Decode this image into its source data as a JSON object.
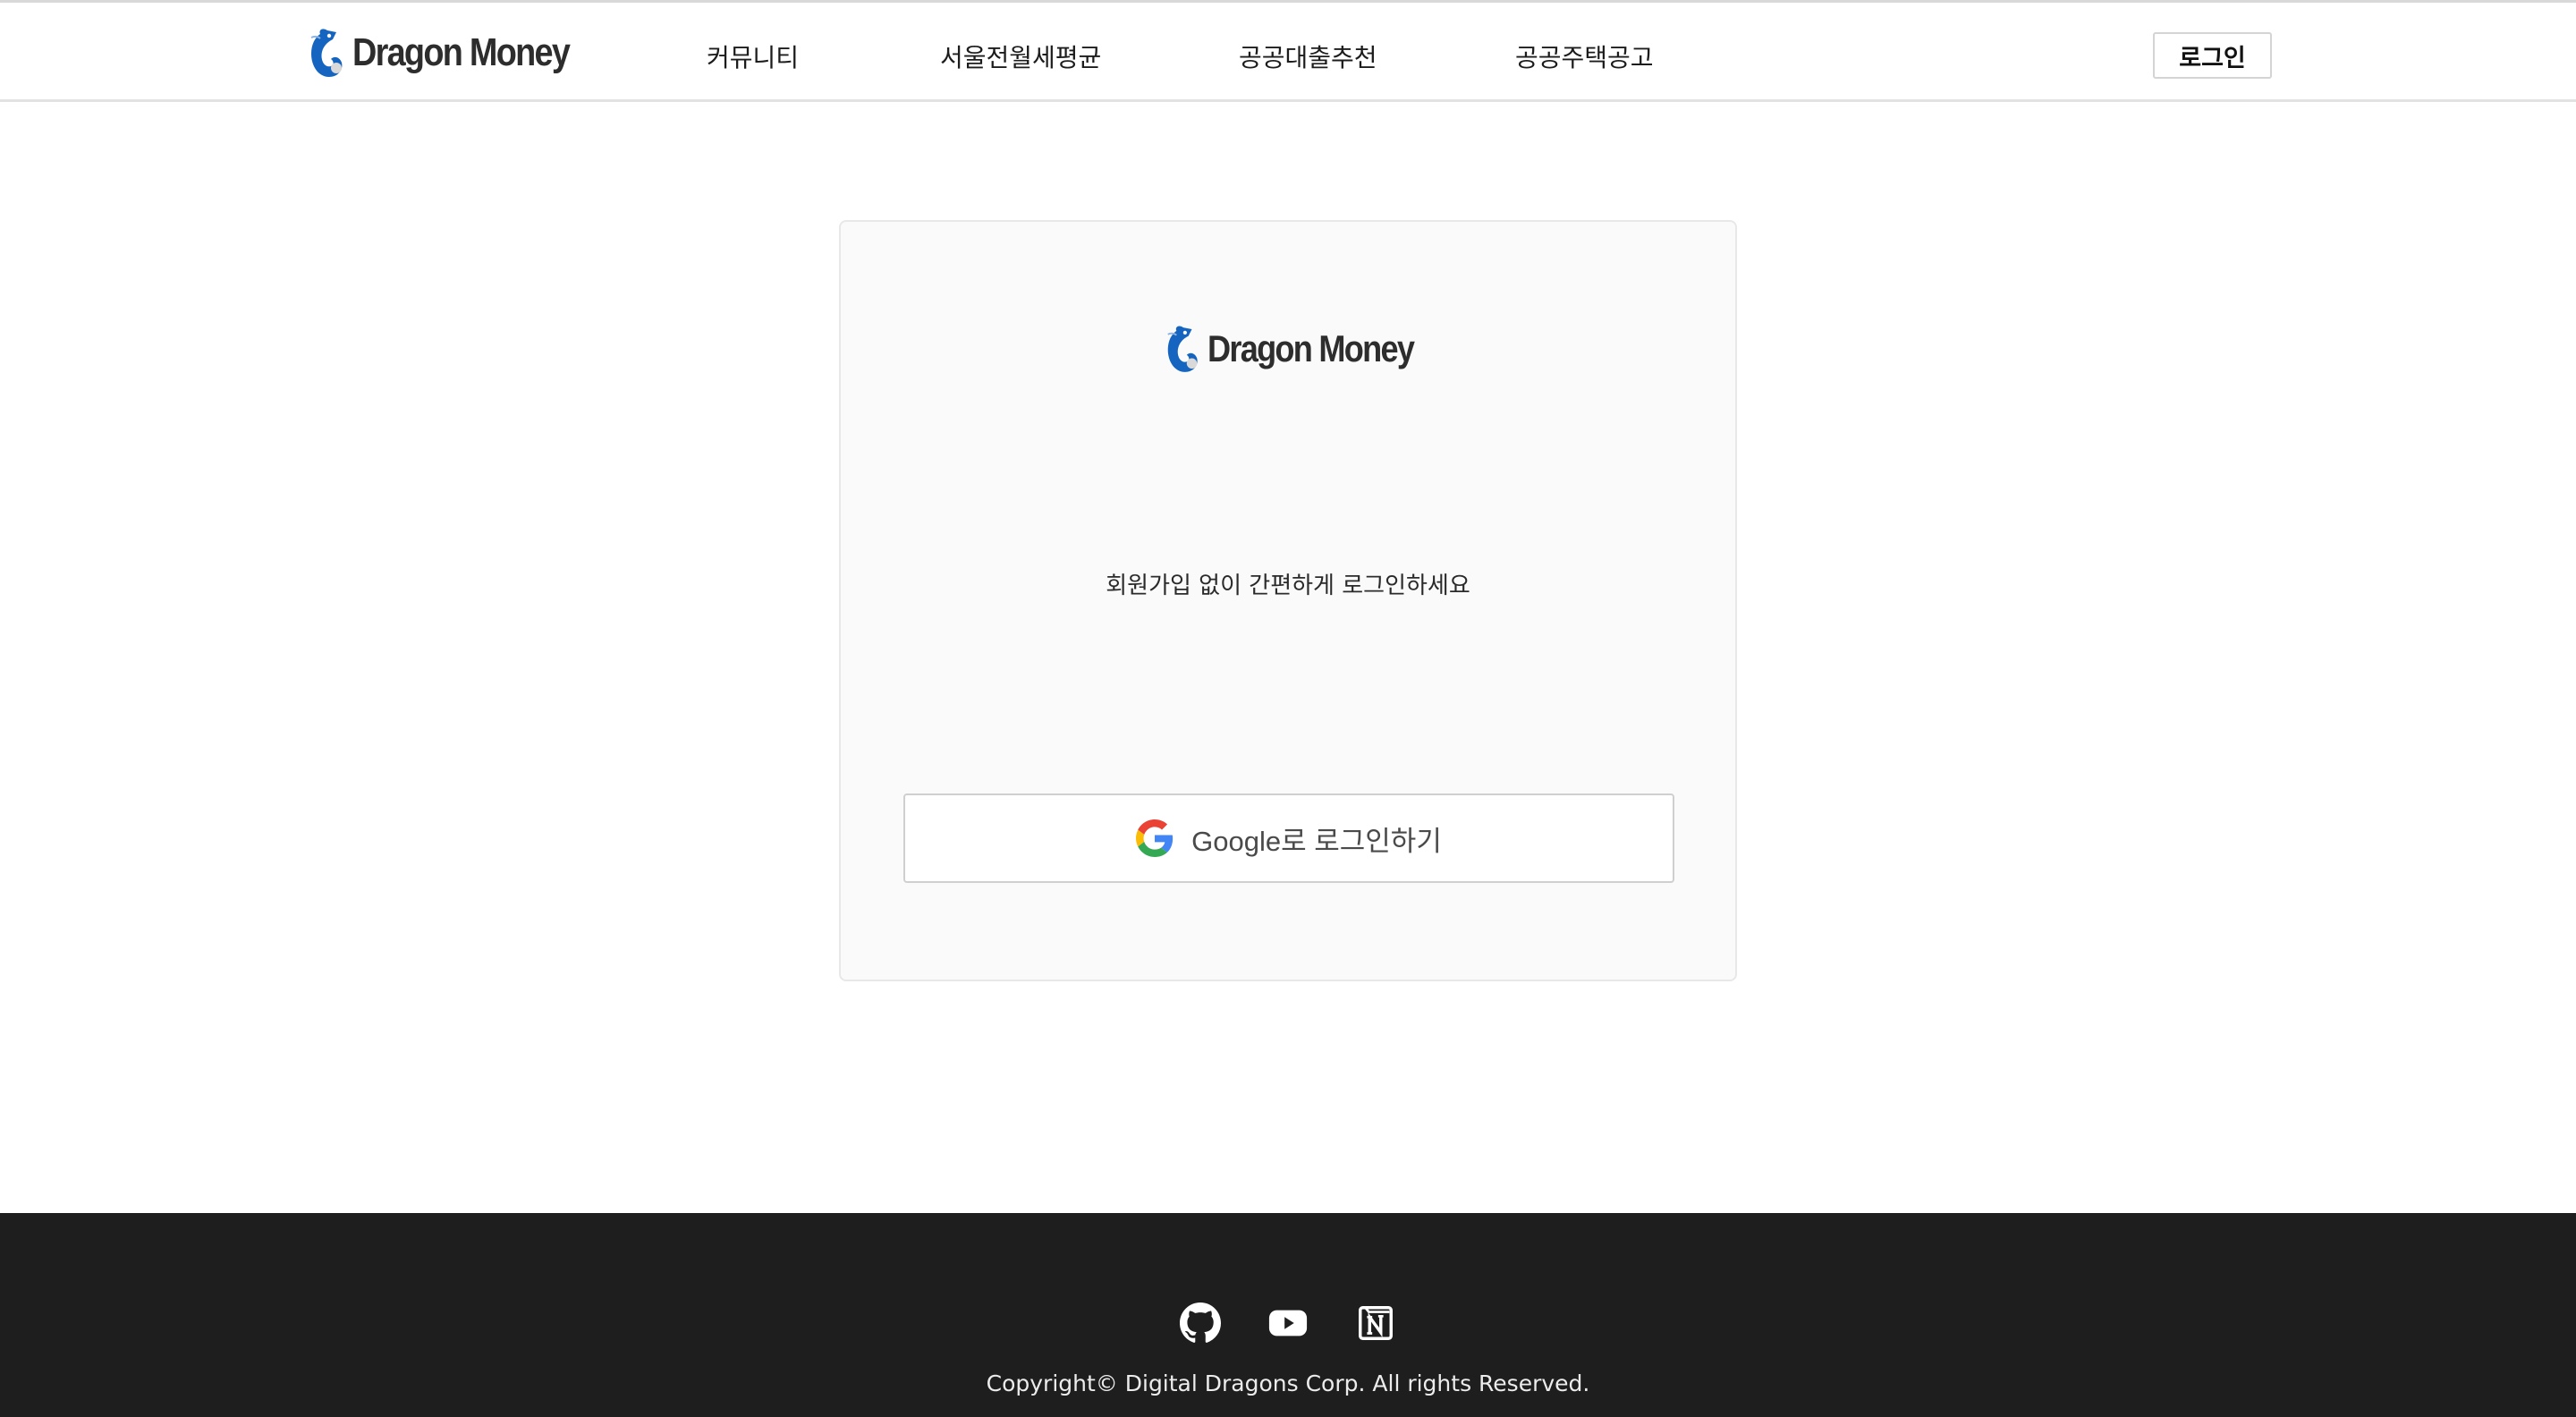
{
  "header": {
    "logo_text": "Dragon Money",
    "nav": [
      {
        "label": "커뮤니티"
      },
      {
        "label": "서울전월세평균"
      },
      {
        "label": "공공대출추천"
      },
      {
        "label": "공공주택공고"
      }
    ],
    "login_label": "로그인"
  },
  "login_card": {
    "logo_text": "Dragon Money",
    "tagline": "회원가입 없이 간편하게 로그인하세요",
    "google_button_label": "Google로 로그인하기"
  },
  "footer": {
    "social_icons": [
      "github-icon",
      "youtube-icon",
      "notion-icon"
    ],
    "copyright": "Copyright© Digital Dragons Corp. All rights Reserved."
  },
  "colors": {
    "brand_blue": "#1565c0",
    "footer_bg": "#1e1e1e",
    "card_bg": "#fafafa",
    "google_blue": "#4285F4",
    "google_red": "#EA4335",
    "google_yellow": "#FBBC05",
    "google_green": "#34A853"
  }
}
